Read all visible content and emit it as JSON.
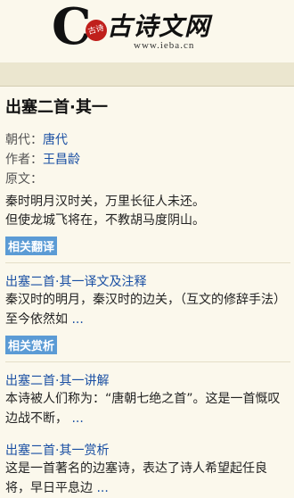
{
  "header": {
    "seal_text": "古诗",
    "logo_text": "古诗文网",
    "url": "www.ieba.cn"
  },
  "poem": {
    "title": "出塞二首·其一",
    "dynasty_label": "朝代：",
    "dynasty": "唐代",
    "author_label": "作者：",
    "author": "王昌龄",
    "text_label": "原文：",
    "lines": [
      "秦时明月汉时关，万里长征人未还。",
      "但使龙城飞将在，不教胡马度阴山。"
    ]
  },
  "translation_section": {
    "label": "相关翻译",
    "items": [
      {
        "title": "出塞二首·其一译文及注释",
        "snippet": "秦汉时的明月，秦汉时的边关，（互文的修辞手法）至今依然如",
        "more": "..."
      }
    ]
  },
  "analysis_section": {
    "label": "相关赏析",
    "items": [
      {
        "title": "出塞二首·其一讲解",
        "snippet": "本诗被人们称为：“唐朝七绝之首”。这是一首慨叹边战不断，",
        "more": "..."
      },
      {
        "title": "出塞二首·其一赏析",
        "snippet": "这是一首著名的边塞诗，表达了诗人希望起任良将，早日平息边",
        "more": "..."
      }
    ]
  }
}
